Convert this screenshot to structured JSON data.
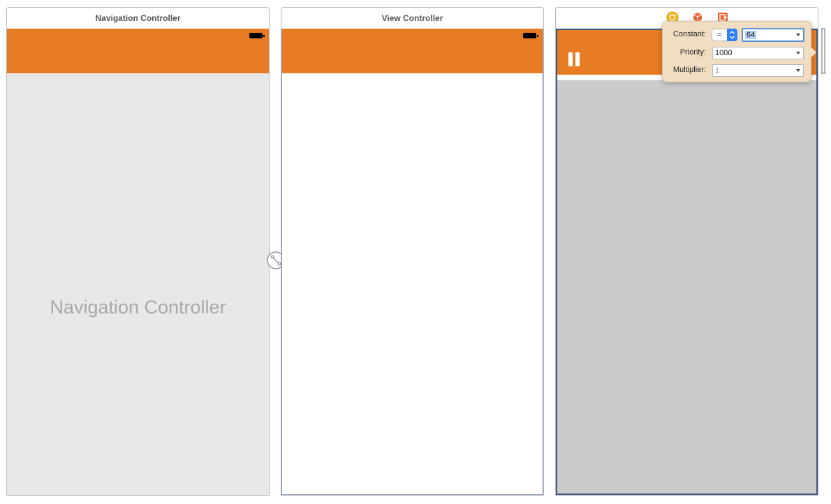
{
  "scenes": [
    {
      "title": "Navigation Controller",
      "placeholder": "Navigation Controller"
    },
    {
      "title": "View Controller"
    },
    {
      "title": ""
    }
  ],
  "dock_icons": [
    "view-controller-icon",
    "first-responder-icon",
    "exit-icon"
  ],
  "colors": {
    "navbar": "#e87c25",
    "popover_bg": "#f1ddc1",
    "selected_scene_border": "#3f5a82",
    "scene_gray": "#cbcbcb"
  },
  "constraint_popover": {
    "constant_label": "Constant:",
    "relation": "=",
    "constant_value": "64",
    "priority_label": "Priority:",
    "priority_value": "1000",
    "multiplier_label": "Multiplier:",
    "multiplier_value": "1"
  }
}
